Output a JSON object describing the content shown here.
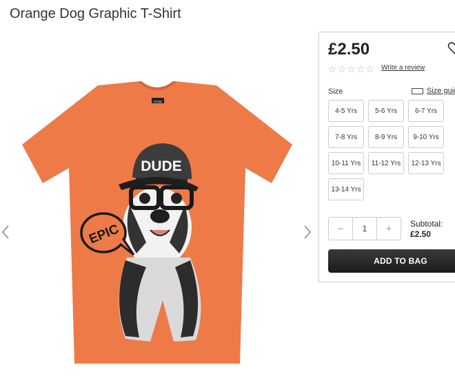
{
  "product": {
    "title": "Orange Dog Graphic T-Shirt",
    "price": "£2.50",
    "rating": {
      "stars": 0,
      "max": 5
    },
    "write_review": "Write a review",
    "image_icon": "orange-dog-tshirt-image",
    "shirt_color": "#ee7a48",
    "tag_text": "George",
    "print_hat_text": "DUDE",
    "print_bubble_text": "EPIC"
  },
  "size": {
    "label": "Size",
    "guide_label": "Size guide",
    "options": [
      "4-5 Yrs",
      "5-6 Yrs",
      "6-7 Yrs",
      "7-8 Yrs",
      "8-9 Yrs",
      "9-10 Yrs",
      "10-11 Yrs",
      "11-12 Yrs",
      "12-13 Yrs",
      "13-14 Yrs"
    ]
  },
  "quantity": {
    "minus": "−",
    "value": "1",
    "plus": "+"
  },
  "subtotal": {
    "label": "Subtotal:",
    "value": "£2.50"
  },
  "cart": {
    "add_label": "ADD TO BAG"
  },
  "gallery": {
    "prev_icon": "chevron-left-icon",
    "next_icon": "chevron-right-icon"
  }
}
